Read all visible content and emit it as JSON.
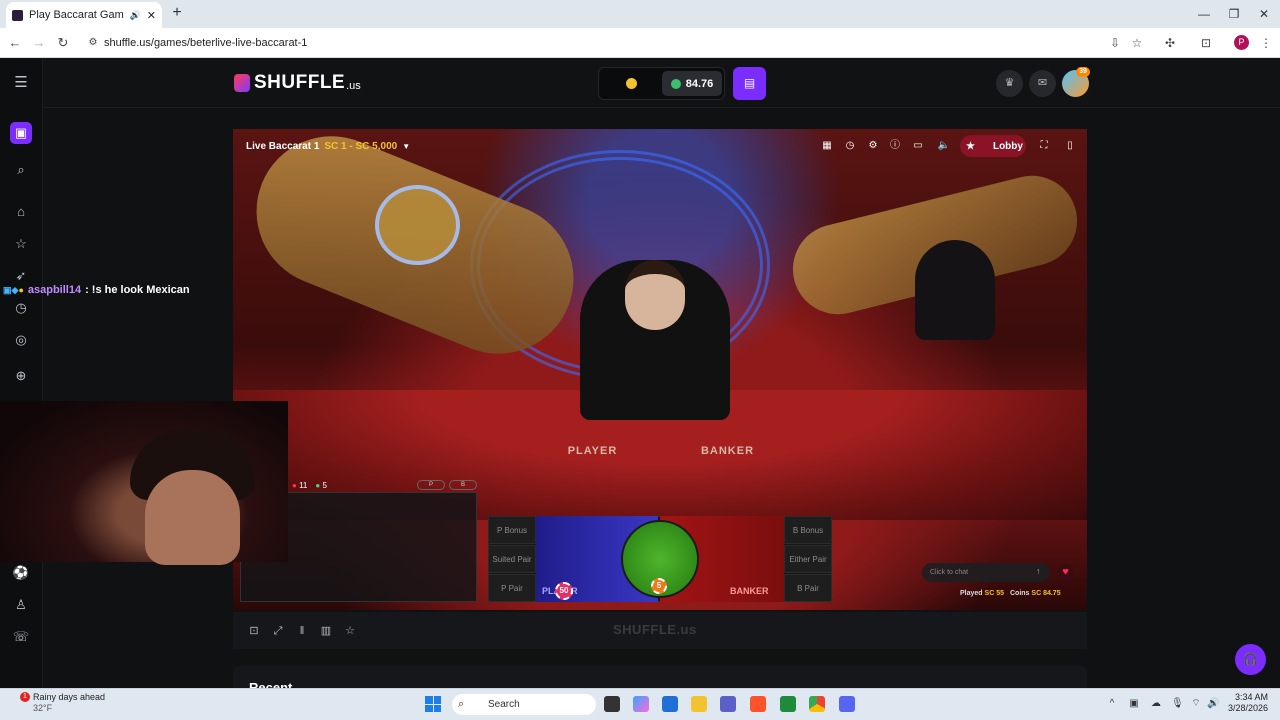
{
  "browser": {
    "tab_title": "Play Baccarat Gambling Ga",
    "url": "shuffle.us/games/beterlive-live-baccarat-1",
    "profile_initial": "P",
    "icons": [
      "back-icon",
      "forward-icon",
      "reload-icon",
      "site-info-icon",
      "install-icon",
      "bookmark-star-icon",
      "extensions-icon",
      "tab-search-icon",
      "menu-icon"
    ]
  },
  "site": {
    "logo_text": "SHUFFLE",
    "logo_tld": ".us",
    "balance": "84.76",
    "avatar_badge": "39",
    "accent_color": "#7b2dff"
  },
  "game": {
    "title": "Live Baccarat 1",
    "limits": "SC 1 - SC 5,000",
    "lobby_label": "Lobby",
    "table_player": "PLAYER",
    "table_banker": "BANKER",
    "side_bets_left": [
      "P Bonus",
      "Suited Pair",
      "P Pair"
    ],
    "side_bets_right": [
      "B Bonus",
      "Either Pair",
      "B Pair"
    ],
    "zone_player": "PLAYER",
    "zone_banker": "BANKER",
    "chip_player": "50",
    "chip_tie": "5",
    "road_stats": {
      "banker_count": "11",
      "player_count": "5"
    },
    "road_buttons": [
      "P",
      "B"
    ],
    "chat_placeholder": "Click to chat",
    "played_label": "Played",
    "played_value": "SC 55",
    "coins_label": "Coins",
    "coins_value": "SC 84.75",
    "footer_watermark": "SHUFFLE.us"
  },
  "page": {
    "recent_label": "Recent"
  },
  "stream_chat": {
    "user": "asapbill14",
    "message": ": !s he look Mexican"
  },
  "taskbar": {
    "weather_title": "Rainy days ahead",
    "weather_temp": "32°F",
    "weather_badge": "1",
    "search_label": "Search",
    "time": "3:34 AM",
    "date": "3/28/2026"
  }
}
